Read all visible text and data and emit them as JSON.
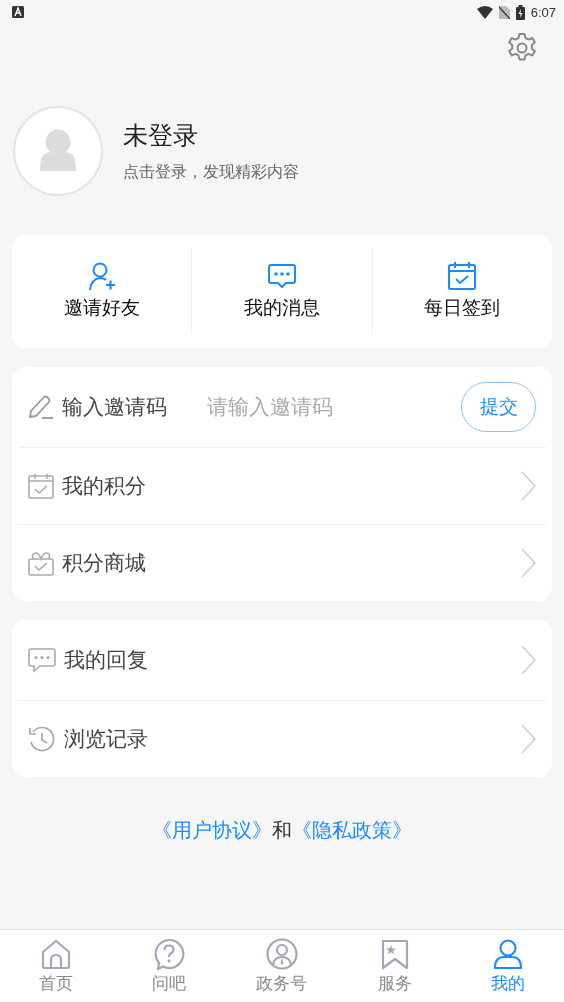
{
  "status_bar": {
    "time": "6:07"
  },
  "profile": {
    "name": "未登录",
    "subtitle": "点击登录，发现精彩内容"
  },
  "quick_actions": [
    {
      "label": "邀请好友"
    },
    {
      "label": "我的消息"
    },
    {
      "label": "每日签到"
    }
  ],
  "menu_groups": [
    {
      "items": [
        {
          "kind": "input",
          "label": "输入邀请码",
          "placeholder": "请输入邀请码",
          "button": "提交"
        },
        {
          "kind": "link",
          "label": "我的积分"
        },
        {
          "kind": "link",
          "label": "积分商城"
        }
      ]
    },
    {
      "items": [
        {
          "kind": "link",
          "label": "我的回复"
        },
        {
          "kind": "link",
          "label": "浏览记录"
        }
      ]
    }
  ],
  "legal": {
    "user_agreement": "《用户协议》",
    "conjunction": "和",
    "privacy_policy": "《隐私政策》"
  },
  "tab_bar": [
    {
      "label": "首页",
      "selected": false
    },
    {
      "label": "问吧",
      "selected": false
    },
    {
      "label": "政务号",
      "selected": false
    },
    {
      "label": "服务",
      "selected": false
    },
    {
      "label": "我的",
      "selected": true
    }
  ]
}
